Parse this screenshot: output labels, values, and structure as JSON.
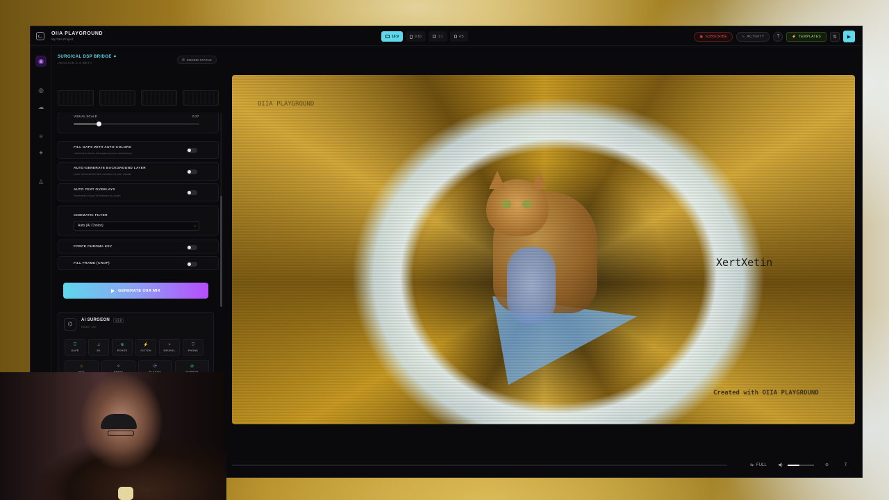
{
  "app": {
    "title": "OIIA PLAYGROUND",
    "subtitle": "My OIIA Project"
  },
  "aspect_ratios": [
    {
      "label": "16:9",
      "active": true
    },
    {
      "label": "9:16",
      "active": false
    },
    {
      "label": "1:1",
      "active": false
    },
    {
      "label": "4:5",
      "active": false
    }
  ],
  "header": {
    "subscribe": "SUBSCRIBE",
    "activity": "ACTIVITY",
    "help_icon": "?",
    "templates": "TEMPLATES"
  },
  "panel": {
    "title": "SURGICAL DSP BRIDGE",
    "version": "VERSION 4.0 BETA",
    "engine_status": "ENGINE STATUS",
    "visual_scale_label": "VISUAL SCALE",
    "visual_scale_value": "0.27",
    "visual_scale_fraction": 0.2,
    "options": [
      {
        "label": "FILL GAPS WITH AUTO-COLORS",
        "desc": "Uncheck to leave transparent (Uses Ambience)"
      },
      {
        "label": "AUTO-GENERATE BACKGROUND LAYER",
        "desc": "Uses blurred/extended versions of your visuals"
      },
      {
        "label": "AUTO TEXT OVERLAYS",
        "desc": "Generates Ghost Text based on Audio"
      }
    ],
    "cinematic_filter_label": "CINEMATIC FILTER",
    "cinematic_filter_value": "Auto (AI Choice)",
    "force_chroma": "FORCE CHROMA KEY",
    "fill_frame": "FILL FRAME (CROP)",
    "generate_button": "GENERATE OIIA MIX"
  },
  "surgeon": {
    "title": "AI SURGEON",
    "version": "V3.5",
    "status": "READY (AI)",
    "effects": [
      "SAFE",
      "8D",
      "ECHOS",
      "GLITCH",
      "NEURAL",
      "PHONK",
      "ROT",
      "PARTY",
      "ELASTIC",
      "HORROR"
    ],
    "effect_colors": [
      "#4ade80",
      "#5fa8ff",
      "#5fd8ec",
      "#f472b6",
      "#f472b6",
      "#c084fc",
      "#fb923c",
      "#e879f9",
      "#c084fc",
      "#4ade80"
    ],
    "effect_icons": [
      "shield-icon",
      "headphones-icon",
      "waves-icon",
      "zap-icon",
      "sparkle-icon",
      "shield-icon",
      "flame-icon",
      "sparkle-icon",
      "refresh-icon",
      "eye-off-icon"
    ]
  },
  "preview": {
    "watermark": "OIIA PLAYGROUND",
    "overlay_name": "XertXetin",
    "credit": "Created with OIIA PLAYGROUND"
  },
  "controls": {
    "full": "FULL",
    "volume": 0.45
  },
  "colors": {
    "accent": "#5fd8ec",
    "purple": "#b64dfc",
    "red": "#e04848",
    "green": "#9be45a"
  }
}
